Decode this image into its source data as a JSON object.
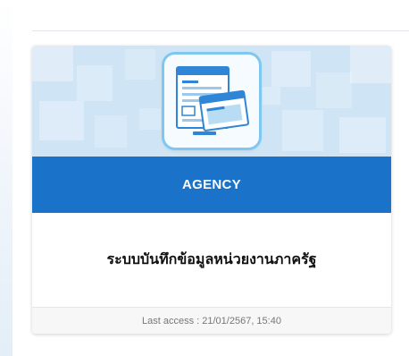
{
  "card": {
    "category": "AGENCY",
    "title": "ระบบบันทึกข้อมูลหน่วยงานภาครัฐ",
    "last_access": "Last access : 21/01/2567, 15:40",
    "icon": "document-form-icon"
  },
  "colors": {
    "band_blue": "#1a73c9",
    "banner_bg": "#cfe4f5",
    "tile_border": "#7fc7ee",
    "form_blue": "#2f86d6"
  }
}
